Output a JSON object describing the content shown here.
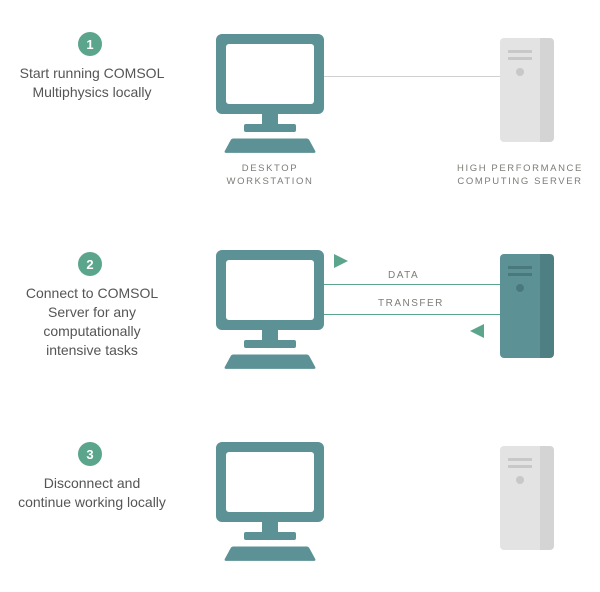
{
  "steps": [
    {
      "number": "1",
      "text": "Start running COMSOL Multiphysics locally",
      "workstation_label": "DESKTOP\nWORKSTATION",
      "server_label": "HIGH PERFORMANCE\nCOMPUTING SERVER"
    },
    {
      "number": "2",
      "text": "Connect to COMSOL Server for any computationally intensive tasks",
      "transfer_top": "DATA",
      "transfer_bottom": "TRANSFER"
    },
    {
      "number": "3",
      "text": "Disconnect and continue working locally"
    }
  ],
  "colors": {
    "accent": "#5aa58b",
    "teal": "#5c9195",
    "gray": "#e3e3e3"
  }
}
